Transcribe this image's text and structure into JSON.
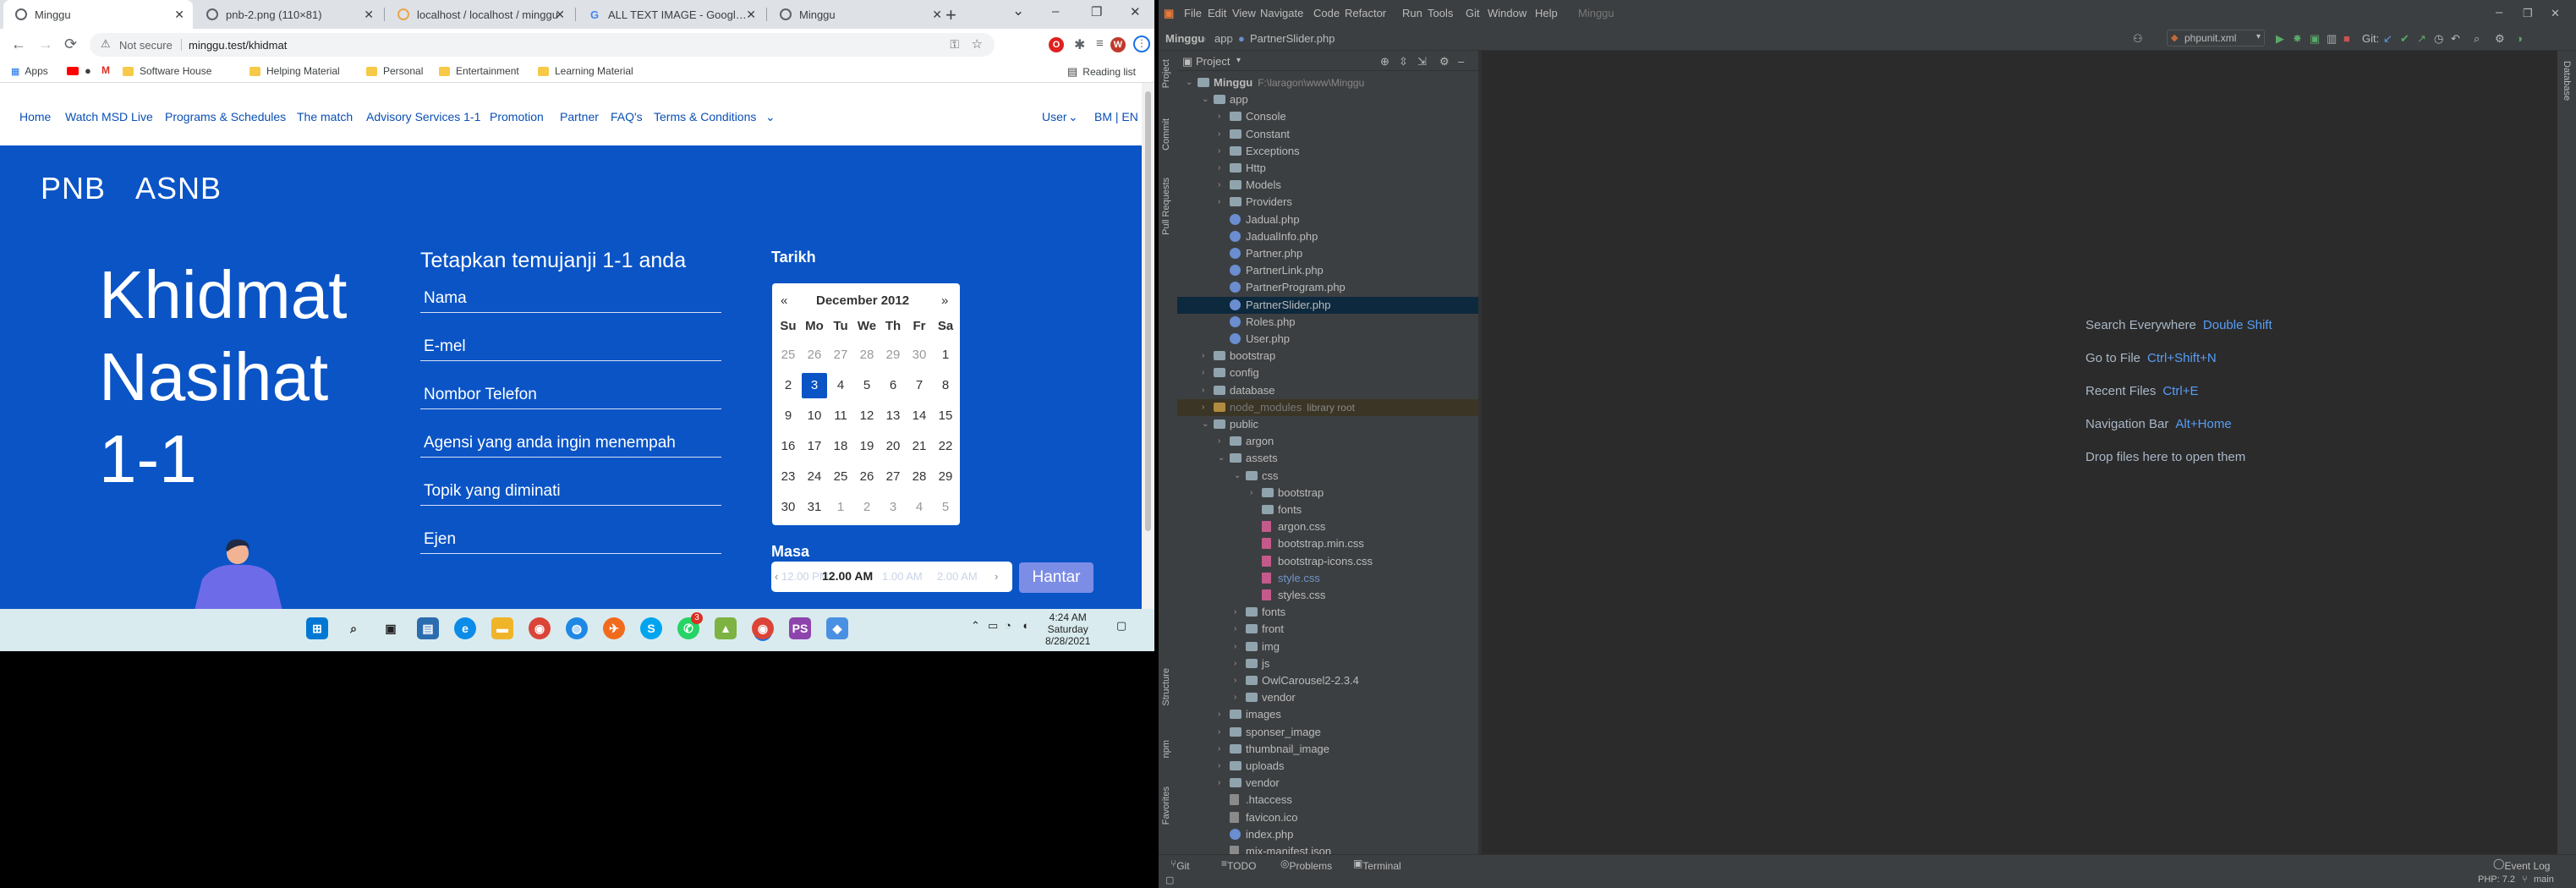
{
  "colors": {
    "hero_blue": "#0a54c6",
    "accent": "#7c8de6",
    "ide_bg": "#2b2b2b",
    "ide_panel": "#3c3f41",
    "ide_link": "#589df6"
  },
  "chrome": {
    "tabs": [
      {
        "title": "Minggu",
        "active": true
      },
      {
        "title": "pnb-2.png (110×81)"
      },
      {
        "title": "localhost / localhost / minggu"
      },
      {
        "title": "ALL TEXT IMAGE - Google Se"
      },
      {
        "title": "Minggu"
      }
    ],
    "new_tab": "+",
    "window_controls": {
      "minimize": "–",
      "maximize": "❐",
      "close": "✕"
    },
    "toolbar": {
      "back": "←",
      "forward": "→",
      "reload": "⟳",
      "not_secure": "Not secure",
      "url": "minggu.test/khidmat",
      "profile_initial": "W"
    },
    "bookmarks": {
      "apps": "Apps",
      "items": [
        "Software House",
        "Helping Material",
        "Personal",
        "Entertainment",
        "Learning Material"
      ],
      "reading_list": "Reading list"
    }
  },
  "site": {
    "nav": {
      "items": [
        "Home",
        "Watch MSD Live",
        "Programs & Schedules",
        "The match",
        "Advisory Services 1-1",
        "Promotion",
        "Partner",
        "FAQ's",
        "Terms & Conditions"
      ],
      "user": "User",
      "lang": "BM | EN"
    },
    "brands": [
      "PNB",
      "ASNB"
    ],
    "hero_title_lines": [
      "Khidmat",
      "Nasihat",
      "1-1"
    ],
    "form": {
      "title": "Tetapkan temujanji 1-1 anda",
      "fields": [
        "Nama",
        "E-mel",
        "Nombor Telefon",
        "Agensi yang anda ingin menempah",
        "Topik yang diminati",
        "Ejen"
      ]
    },
    "date_label": "Tarikh",
    "calendar": {
      "month": "December 2012",
      "prev": "«",
      "next": "»",
      "weekdays": [
        "Su",
        "Mo",
        "Tu",
        "We",
        "Th",
        "Fr",
        "Sa"
      ],
      "weeks": [
        [
          "25",
          "26",
          "27",
          "28",
          "29",
          "30",
          "1"
        ],
        [
          "2",
          "3",
          "4",
          "5",
          "6",
          "7",
          "8"
        ],
        [
          "9",
          "10",
          "11",
          "12",
          "13",
          "14",
          "15"
        ],
        [
          "16",
          "17",
          "18",
          "19",
          "20",
          "21",
          "22"
        ],
        [
          "23",
          "24",
          "25",
          "26",
          "27",
          "28",
          "29"
        ],
        [
          "30",
          "31",
          "1",
          "2",
          "3",
          "4",
          "5"
        ]
      ],
      "selected": "3"
    },
    "time_label": "Masa",
    "times": [
      "12.00 PM",
      "12.00 AM",
      "1.00 AM",
      "2.00 AM"
    ],
    "submit": "Hantar"
  },
  "taskbar": {
    "time": "4:24 AM",
    "day": "Saturday",
    "date": "8/28/2021",
    "badge": "3"
  },
  "ide": {
    "menu": [
      "File",
      "Edit",
      "View",
      "Navigate",
      "Code",
      "Refactor",
      "Run",
      "Tools",
      "Git",
      "Window",
      "Help"
    ],
    "project_title": "Minggu",
    "breadcrumb": [
      "Minggu",
      "app",
      "PartnerSlider.php"
    ],
    "run_config": "phpunit.xml",
    "git_label": "Git:",
    "panel_title": "Project",
    "left_tabs": [
      "Project",
      "Commit",
      "Pull Requests",
      "Structure",
      "npm",
      "Favorites"
    ],
    "right_tabs": [
      "Database"
    ],
    "tree": [
      {
        "name": "Minggu",
        "path": "F:\\laragon\\www\\Minggu",
        "depth": 0,
        "type": "folder",
        "open": true,
        "bold": true
      },
      {
        "name": "app",
        "depth": 1,
        "type": "folder",
        "open": true
      },
      {
        "name": "Console",
        "depth": 2,
        "type": "folder"
      },
      {
        "name": "Constant",
        "depth": 2,
        "type": "folder"
      },
      {
        "name": "Exceptions",
        "depth": 2,
        "type": "folder"
      },
      {
        "name": "Http",
        "depth": 2,
        "type": "folder"
      },
      {
        "name": "Models",
        "depth": 2,
        "type": "folder"
      },
      {
        "name": "Providers",
        "depth": 2,
        "type": "folder"
      },
      {
        "name": "Jadual.php",
        "depth": 2,
        "type": "php"
      },
      {
        "name": "JadualInfo.php",
        "depth": 2,
        "type": "php"
      },
      {
        "name": "Partner.php",
        "depth": 2,
        "type": "php"
      },
      {
        "name": "PartnerLink.php",
        "depth": 2,
        "type": "php"
      },
      {
        "name": "PartnerProgram.php",
        "depth": 2,
        "type": "php"
      },
      {
        "name": "PartnerSlider.php",
        "depth": 2,
        "type": "php",
        "selected": true
      },
      {
        "name": "Roles.php",
        "depth": 2,
        "type": "php"
      },
      {
        "name": "User.php",
        "depth": 2,
        "type": "php"
      },
      {
        "name": "bootstrap",
        "depth": 1,
        "type": "folder"
      },
      {
        "name": "config",
        "depth": 1,
        "type": "folder"
      },
      {
        "name": "database",
        "depth": 1,
        "type": "folder"
      },
      {
        "name": "node_modules",
        "path": "library root",
        "depth": 1,
        "type": "folder",
        "excluded": true
      },
      {
        "name": "public",
        "depth": 1,
        "type": "folder",
        "open": true
      },
      {
        "name": "argon",
        "depth": 2,
        "type": "folder"
      },
      {
        "name": "assets",
        "depth": 2,
        "type": "folder",
        "open": true
      },
      {
        "name": "css",
        "depth": 3,
        "type": "folder",
        "open": true
      },
      {
        "name": "bootstrap",
        "depth": 4,
        "type": "folder"
      },
      {
        "name": "fonts",
        "depth": 4,
        "type": "folder",
        "nochev": true
      },
      {
        "name": "argon.css",
        "depth": 4,
        "type": "css"
      },
      {
        "name": "bootstrap.min.css",
        "depth": 4,
        "type": "css"
      },
      {
        "name": "bootstrap-icons.css",
        "depth": 4,
        "type": "css",
        "nochev": true
      },
      {
        "name": "style.css",
        "depth": 4,
        "type": "css",
        "nochev": true,
        "link": true
      },
      {
        "name": "styles.css",
        "depth": 4,
        "type": "css",
        "nochev": true
      },
      {
        "name": "fonts",
        "depth": 3,
        "type": "folder"
      },
      {
        "name": "front",
        "depth": 3,
        "type": "folder"
      },
      {
        "name": "img",
        "depth": 3,
        "type": "folder"
      },
      {
        "name": "js",
        "depth": 3,
        "type": "folder"
      },
      {
        "name": "OwlCarousel2-2.3.4",
        "depth": 3,
        "type": "folder"
      },
      {
        "name": "vendor",
        "depth": 3,
        "type": "folder"
      },
      {
        "name": "images",
        "depth": 2,
        "type": "folder"
      },
      {
        "name": "sponser_image",
        "depth": 2,
        "type": "folder"
      },
      {
        "name": "thumbnail_image",
        "depth": 2,
        "type": "folder"
      },
      {
        "name": "uploads",
        "depth": 2,
        "type": "folder"
      },
      {
        "name": "vendor",
        "depth": 2,
        "type": "folder"
      },
      {
        "name": ".htaccess",
        "depth": 2,
        "type": "file"
      },
      {
        "name": "favicon.ico",
        "depth": 2,
        "type": "file"
      },
      {
        "name": "index.php",
        "depth": 2,
        "type": "php"
      },
      {
        "name": "mix-manifest.json",
        "depth": 2,
        "type": "file"
      }
    ],
    "hints": [
      {
        "label": "Search Everywhere",
        "key": "Double Shift"
      },
      {
        "label": "Go to File",
        "key": "Ctrl+Shift+N"
      },
      {
        "label": "Recent Files",
        "key": "Ctrl+E"
      },
      {
        "label": "Navigation Bar",
        "key": "Alt+Home"
      },
      {
        "label": "Drop files here to open them",
        "key": ""
      }
    ],
    "bottom_tabs": [
      "Git",
      "TODO",
      "Problems",
      "Terminal"
    ],
    "event_log": "Event Log",
    "status_right": "PHP: 7.2",
    "branch": "main"
  }
}
